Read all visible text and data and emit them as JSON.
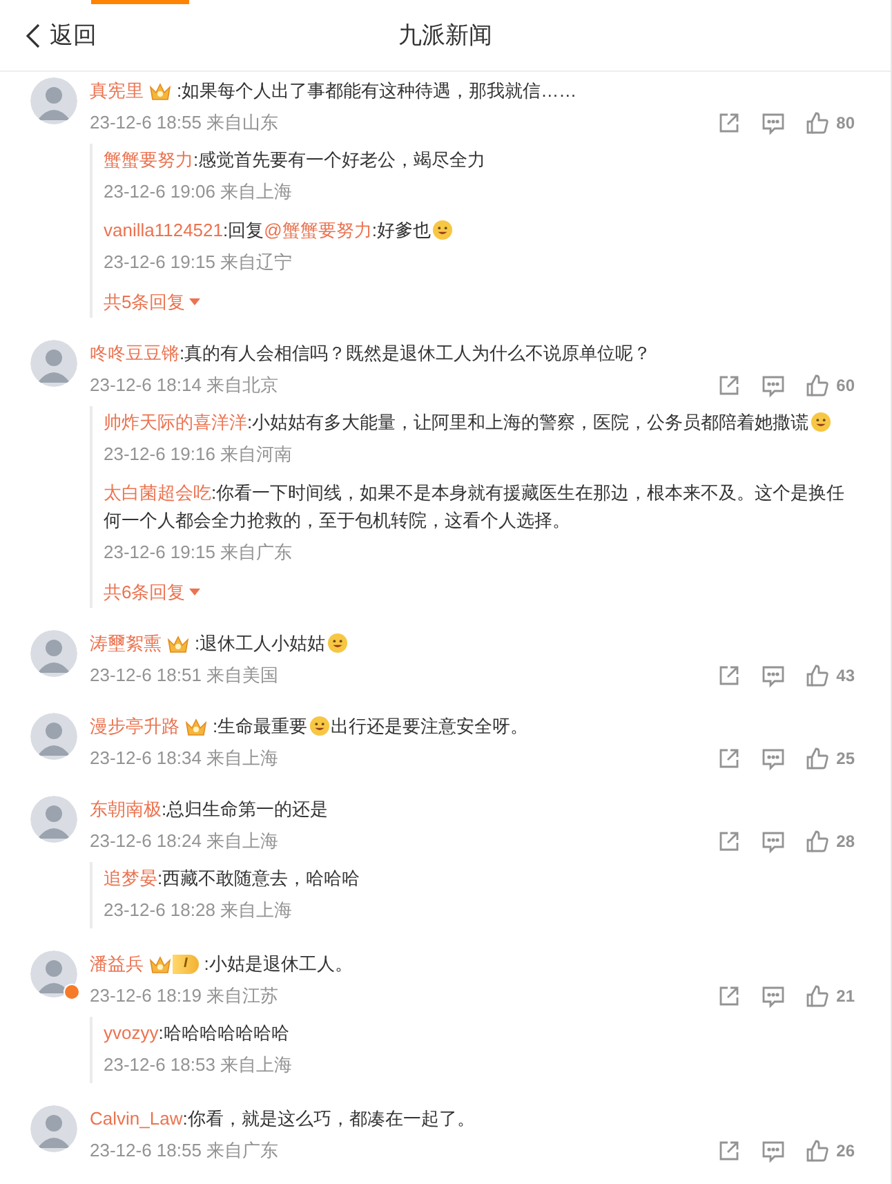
{
  "header": {
    "back": "返回",
    "title": "九派新闻"
  },
  "comments": [
    {
      "name": "真宪里",
      "badge": {
        "kind": "crown"
      },
      "verified": false,
      "content": [
        {
          "kind": "text",
          "text": ":如果每个人出了事都能有这种待遇，那我就信……"
        }
      ],
      "meta": "23-12-6 18:55 来自山东",
      "likes": "80",
      "replies": [
        {
          "name": "蟹蟹要努力",
          "content": [
            {
              "kind": "text",
              "text": ":感觉首先要有一个好老公，竭尽全力"
            }
          ],
          "meta": "23-12-6 19:06 来自上海"
        },
        {
          "name": "vanilla1124521",
          "content": [
            {
              "kind": "text",
              "text": ":回复"
            },
            {
              "kind": "mention",
              "text": "@蟹蟹要努力"
            },
            {
              "kind": "text",
              "text": ":好爹也"
            },
            {
              "kind": "emoji"
            }
          ],
          "meta": "23-12-6 19:15 来自辽宁"
        }
      ],
      "more": "共5条回复"
    },
    {
      "name": "咚咚豆豆锵",
      "verified": false,
      "content": [
        {
          "kind": "text",
          "text": ":真的有人会相信吗？既然是退休工人为什么不说原单位呢？"
        }
      ],
      "meta": "23-12-6 18:14 来自北京",
      "likes": "60",
      "replies": [
        {
          "name": "帅炸天际的喜洋洋",
          "content": [
            {
              "kind": "text",
              "text": ":小姑姑有多大能量，让阿里和上海的警察，医院，公务员都陪着她撒谎"
            },
            {
              "kind": "emoji"
            }
          ],
          "meta": "23-12-6 19:16 来自河南"
        },
        {
          "name": "太白菌超会吃",
          "content": [
            {
              "kind": "text",
              "text": ":你看一下时间线，如果不是本身就有援藏医生在那边，根本来不及。这个是换任何一个人都会全力抢救的，至于包机转院，这看个人选择。"
            }
          ],
          "meta": "23-12-6 19:15 来自广东"
        }
      ],
      "more": "共6条回复"
    },
    {
      "name": "涛壐絮熏",
      "badge": {
        "kind": "crown"
      },
      "verified": false,
      "content": [
        {
          "kind": "text",
          "text": ":退休工人小姑姑"
        },
        {
          "kind": "emoji"
        }
      ],
      "meta": "23-12-6 18:51 来自美国",
      "likes": "43"
    },
    {
      "name": "漫步亭升路",
      "badge": {
        "kind": "crown"
      },
      "verified": false,
      "content": [
        {
          "kind": "text",
          "text": ":生命最重要"
        },
        {
          "kind": "emoji"
        },
        {
          "kind": "text",
          "text": "出行还是要注意安全呀。"
        }
      ],
      "meta": "23-12-6 18:34 来自上海",
      "likes": "25"
    },
    {
      "name": "东朝南极",
      "verified": false,
      "content": [
        {
          "kind": "text",
          "text": ":总归生命第一的还是"
        }
      ],
      "meta": "23-12-6 18:24 来自上海",
      "likes": "28",
      "replies": [
        {
          "name": "追梦晏",
          "content": [
            {
              "kind": "text",
              "text": ":西藏不敢随意去，哈哈哈"
            }
          ],
          "meta": "23-12-6 18:28 来自上海"
        }
      ]
    },
    {
      "name": "潘益兵",
      "badge": {
        "kind": "level",
        "label": "I"
      },
      "verified": true,
      "content": [
        {
          "kind": "text",
          "text": ":小姑是退休工人。"
        }
      ],
      "meta": "23-12-6 18:19 来自江苏",
      "likes": "21",
      "replies": [
        {
          "name": "yvozyy",
          "content": [
            {
              "kind": "text",
              "text": ":哈哈哈哈哈哈哈"
            }
          ],
          "meta": "23-12-6 18:53 来自上海"
        }
      ]
    },
    {
      "name": "Calvin_Law",
      "verified": false,
      "content": [
        {
          "kind": "text",
          "text": ":你看，就是这么巧，都凑在一起了。"
        }
      ],
      "meta": "23-12-6 18:55 来自广东",
      "likes": "26"
    }
  ]
}
